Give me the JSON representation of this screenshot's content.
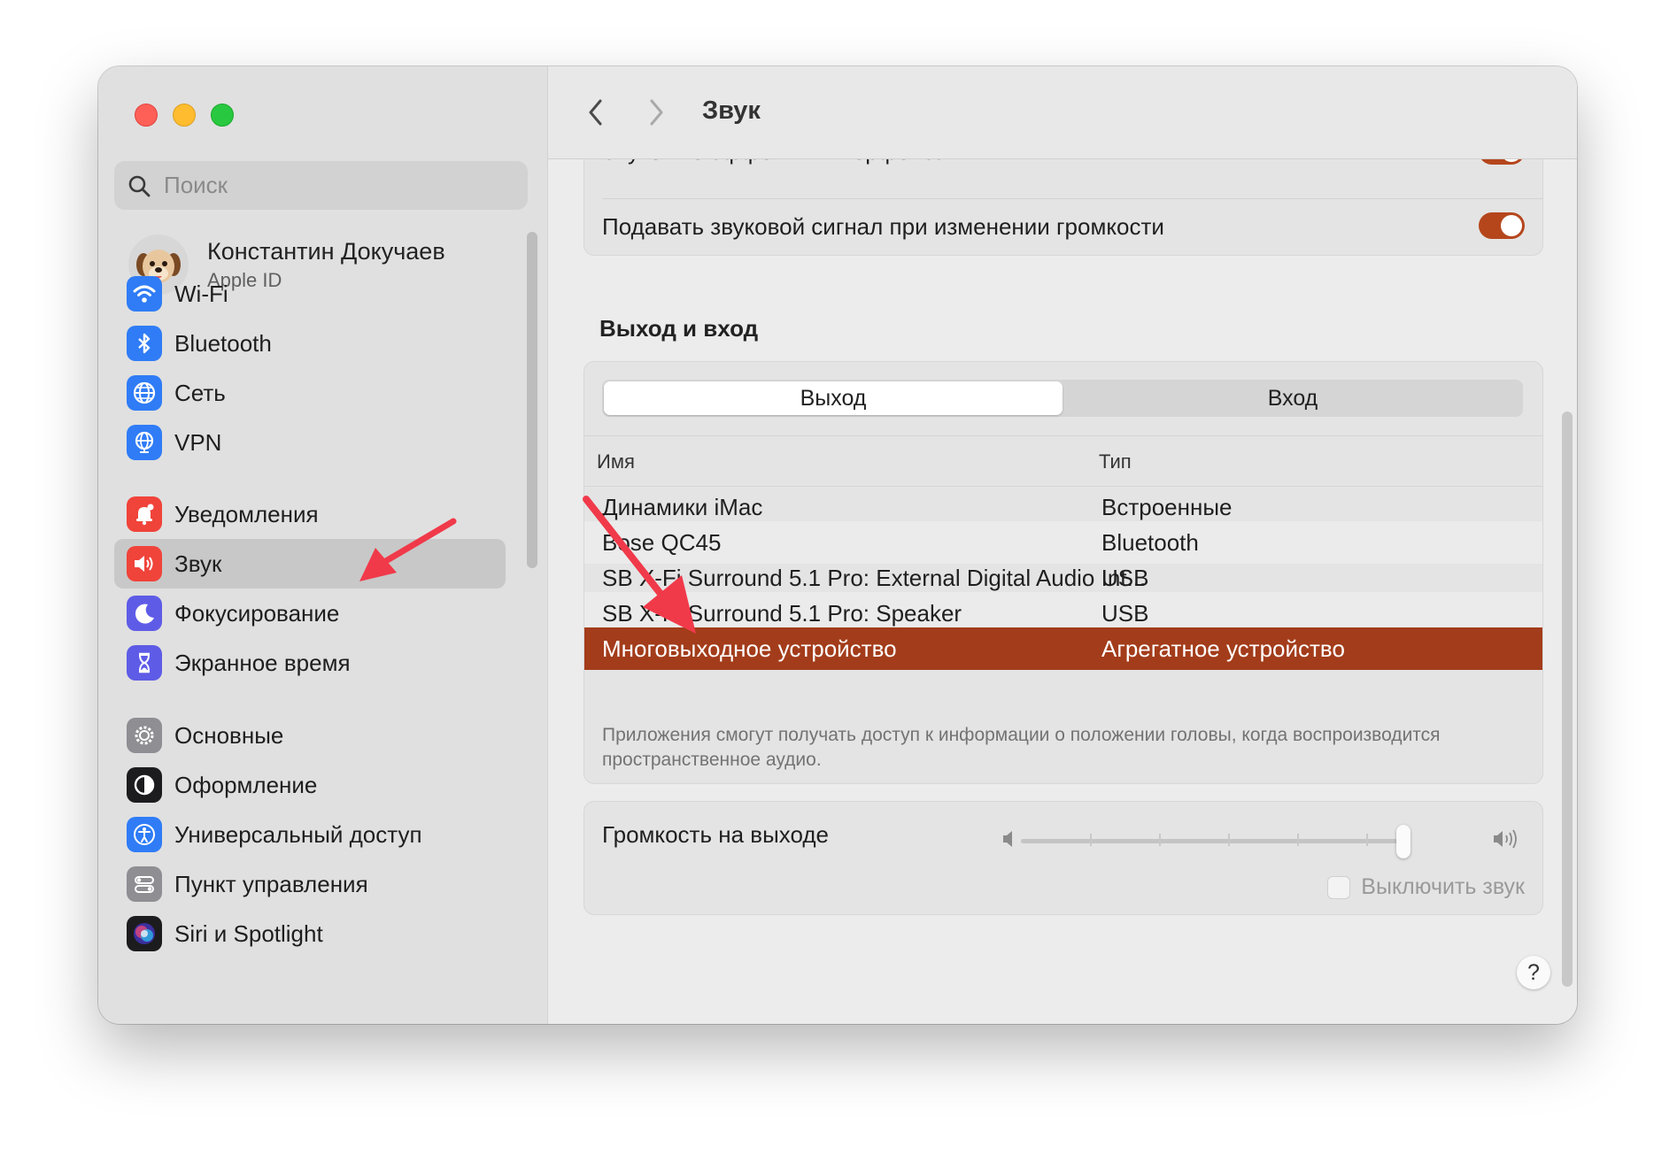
{
  "window": {
    "title": "Звук"
  },
  "search": {
    "placeholder": "Поиск"
  },
  "account": {
    "name": "Константин Докучаев",
    "subtitle": "Apple ID"
  },
  "sidebar": {
    "items": [
      {
        "label": "Wi-Fi",
        "icon": "wifi-icon",
        "color": "#2f7cf6"
      },
      {
        "label": "Bluetooth",
        "icon": "bluetooth-icon",
        "color": "#2f7cf6"
      },
      {
        "label": "Сеть",
        "icon": "globe-icon",
        "color": "#2f7cf6"
      },
      {
        "label": "VPN",
        "icon": "vpn-globe-icon",
        "color": "#2f7cf6"
      },
      {
        "label": "Уведомления",
        "icon": "bell-icon",
        "color": "#f0433a"
      },
      {
        "label": "Звук",
        "icon": "speaker-icon",
        "color": "#f0433a",
        "selected": true
      },
      {
        "label": "Фокусирование",
        "icon": "moon-icon",
        "color": "#5e5ce6"
      },
      {
        "label": "Экранное время",
        "icon": "hourglass-icon",
        "color": "#5e5ce6"
      },
      {
        "label": "Основные",
        "icon": "gear-icon",
        "color": "#8e8e93"
      },
      {
        "label": "Оформление",
        "icon": "appearance-icon",
        "color": "#1c1c1e"
      },
      {
        "label": "Универсальный доступ",
        "icon": "accessibility-icon",
        "color": "#2f7cf6"
      },
      {
        "label": "Пункт управления",
        "icon": "control-center-icon",
        "color": "#8e8e93"
      },
      {
        "label": "Siri и Spotlight",
        "icon": "siri-icon",
        "color": "#1c1c1e"
      }
    ]
  },
  "header": {
    "back": "назад",
    "forward": "вперёд"
  },
  "sound_effects": {
    "ui_effects_label": "Звуковые эффекты интерфейса",
    "ui_effects_on": true,
    "volume_feedback_label": "Подавать звуковой сигнал при изменении громкости",
    "volume_feedback_on": true
  },
  "io": {
    "section_title": "Выход и вход",
    "tabs": [
      "Выход",
      "Вход"
    ],
    "active_tab": 0,
    "columns": [
      "Имя",
      "Тип"
    ],
    "rows": [
      {
        "name": "Динамики iMac",
        "type": "Встроенные"
      },
      {
        "name": "Bose QC45",
        "type": "Bluetooth"
      },
      {
        "name": "SB X-Fi Surround 5.1 Pro: External Digital Audio Int...",
        "type": "USB"
      },
      {
        "name": "SB X-Fi Surround 5.1 Pro: Speaker",
        "type": "USB"
      },
      {
        "name": "Многовыходное устройство",
        "type": "Агрегатное устройство",
        "selected": true
      }
    ],
    "note": "Приложения смогут получать доступ к информации о положении головы, когда воспроизводится пространственное аудио."
  },
  "volume": {
    "label": "Громкость на выходе",
    "level": 1.0,
    "mute_label": "Выключить звук",
    "muted": false
  },
  "help": {
    "label": "?"
  },
  "colors": {
    "accent": "#b5461c",
    "selected_row": "#a33c1a",
    "annotation_arrow": "#f03a4a"
  }
}
